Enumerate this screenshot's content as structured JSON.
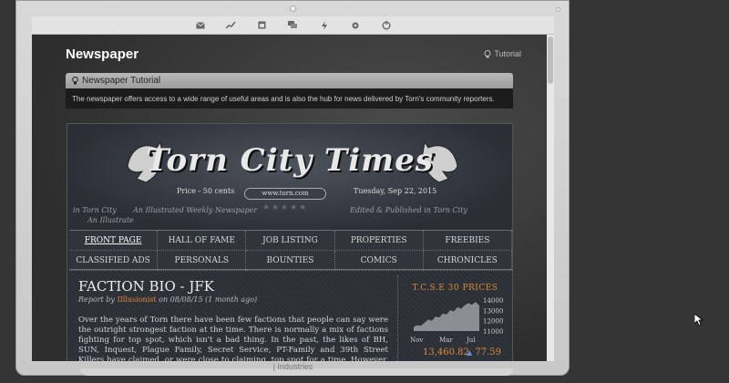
{
  "page": {
    "title": "Newspaper",
    "tutorial_link": "Tutorial"
  },
  "tutorial": {
    "heading": "Newspaper Tutorial",
    "body": "The newspaper offers access to a wide range of useful areas and is also the hub for news delivered by Torn's community reporters."
  },
  "masthead": {
    "title": "Torn City Times",
    "price": "Price - 50 cents",
    "url": "www.torn.com",
    "date": "Tuesday, Sep 22, 2015",
    "left_sub_1": "in Torn City",
    "left_sub_2": "An Illustrated Weekly Newspaper",
    "left_sub_3": "An Illustrate",
    "right_sub": "Edited & Published in Torn City"
  },
  "menu": [
    "FRONT PAGE",
    "HALL OF FAME",
    "JOB LISTING",
    "PROPERTIES",
    "FREEBIES",
    "CLASSIFIED ADS",
    "PERSONALS",
    "BOUNTIES",
    "COMICS",
    "CHRONICLES"
  ],
  "article": {
    "title": "FACTION BIO - JFK",
    "meta_prefix": "Report by",
    "author": "IIllusionist",
    "meta_suffix": "on 08/08/15 (1 month ago)",
    "body": "Over the years of Torn there have been few factions that people can say were the outright strongest faction at the time. There is normally a mix of factions fighting for top spot, which isn't a bad thing. In the past, the likes of BH, SUN, Inquest, Plague Family, Secret Service, PT-Family and 39th Street Killers have claimed, or were close to claiming, top spot for a time. However, there are even fewer factions that can say"
  },
  "tcse": {
    "title": "T.C.S.E 30 PRICES",
    "price": "13,460.82",
    "change": "77.59",
    "y_ticks": [
      "14000",
      "13000",
      "12000",
      "11000"
    ],
    "x_ticks": [
      "Nov",
      "Mar",
      "Jul"
    ],
    "series": [
      11400,
      11550,
      11500,
      11800,
      12100,
      12000,
      12400,
      12300,
      12700,
      12600,
      13000,
      12900,
      13300,
      13150,
      13500,
      13700,
      13550,
      13800,
      13460
    ]
  },
  "statusbar": {
    "text": "| Industries"
  },
  "icons": [
    "mail-icon",
    "chart-icon",
    "calendar-icon",
    "chat-icon",
    "bolt-icon",
    "gear-icon",
    "power-icon"
  ]
}
